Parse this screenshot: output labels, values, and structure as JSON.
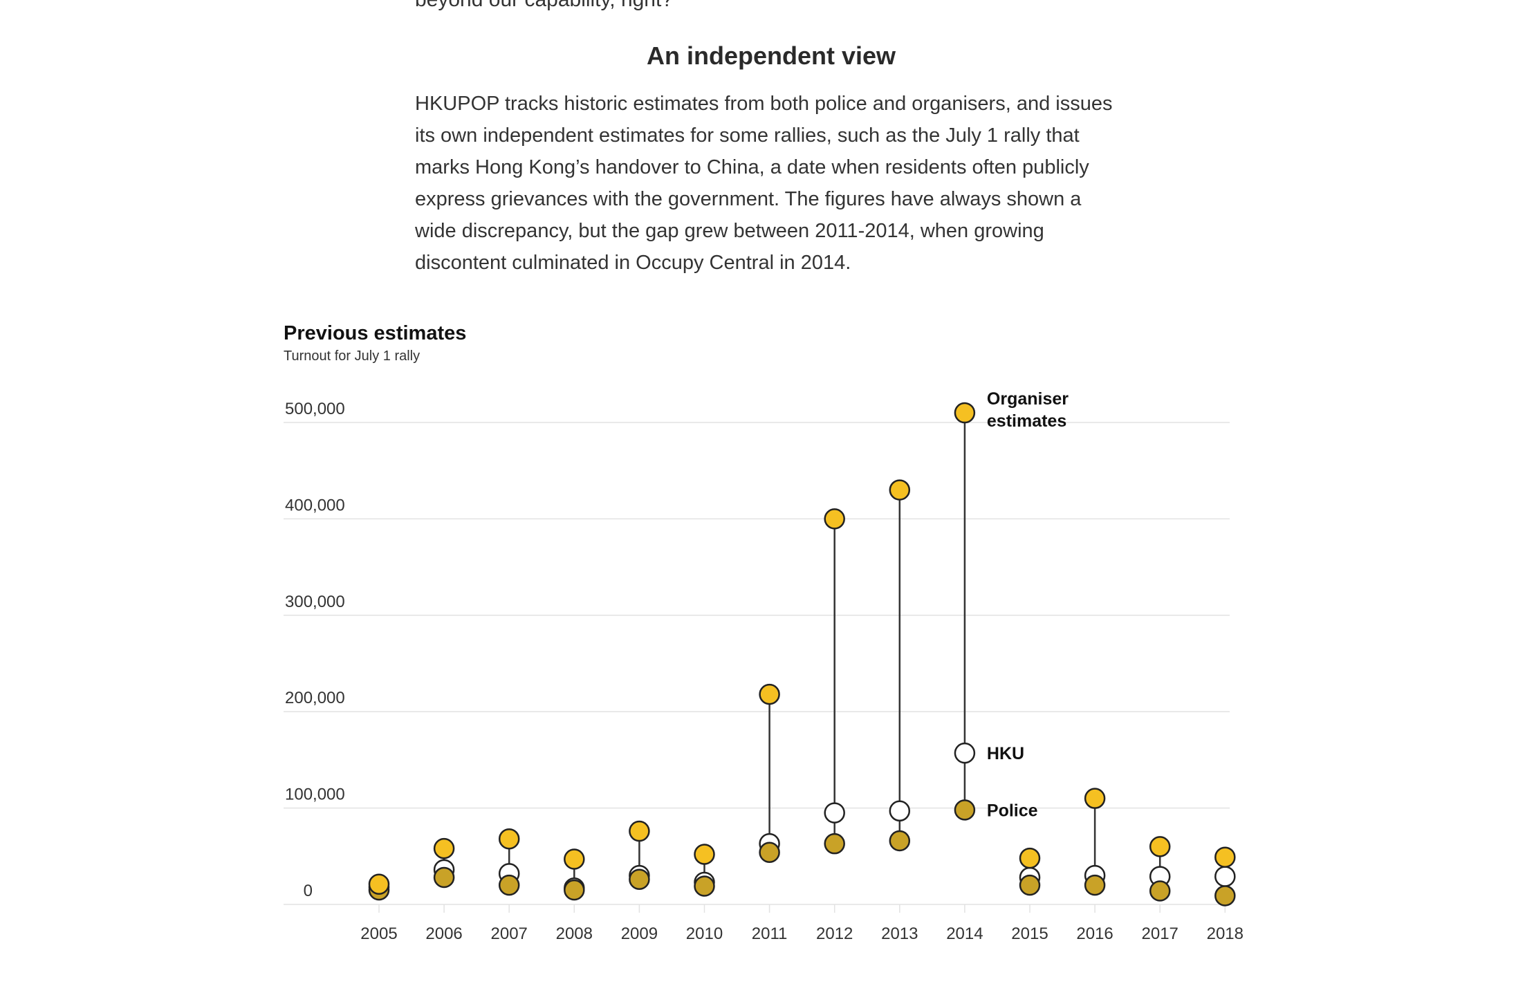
{
  "article": {
    "cut_line": "beyond our capability, right?",
    "section_heading": "An independent view",
    "paragraph": "HKUPOP tracks historic estimates from both police and organisers, and issues its own independent estimates for some rallies, such as the July 1 rally that marks Hong Kong’s handover to China, a date when residents often publicly express grievances with the government. The figures have always shown a wide discrepancy, but the gap grew between 2011-2014, when growing discontent culminated in Occupy Central in 2014."
  },
  "colors": {
    "organiser": "#f5c022",
    "police": "#c9a227",
    "hku_fill": "#ffffff",
    "outline": "#222222",
    "gridline": "#e2e2e2",
    "connector": "#333333"
  },
  "chart_data": {
    "type": "scatter",
    "title": "Previous estimates",
    "subtitle": "Turnout for July 1 rally",
    "x": [
      2005,
      2006,
      2007,
      2008,
      2009,
      2010,
      2011,
      2012,
      2013,
      2014,
      2015,
      2016,
      2017,
      2018
    ],
    "ylim": [
      0,
      500000
    ],
    "yticks": [
      0,
      100000,
      200000,
      300000,
      400000,
      500000
    ],
    "ytick_labels": [
      "0",
      "100,000",
      "200,000",
      "300,000",
      "400,000",
      "500,000"
    ],
    "grid": true,
    "series": [
      {
        "name": "Organiser estimates",
        "values": [
          21000,
          58000,
          68000,
          47000,
          76000,
          52000,
          218000,
          400000,
          430000,
          510000,
          48000,
          110000,
          60000,
          49000
        ]
      },
      {
        "name": "HKU",
        "values": [
          18000,
          36000,
          32000,
          17000,
          30000,
          23000,
          63000,
          95000,
          97000,
          157000,
          28000,
          30000,
          29000,
          29000
        ]
      },
      {
        "name": "Police",
        "values": [
          15000,
          28000,
          20000,
          15000,
          26000,
          19000,
          54000,
          63000,
          66000,
          98000,
          20000,
          20000,
          14000,
          9000
        ]
      }
    ],
    "annotations": [
      {
        "lines": [
          "Organiser",
          "estimates"
        ],
        "series": 0
      },
      {
        "lines": [
          "HKU"
        ],
        "series": 1
      },
      {
        "lines": [
          "Police"
        ],
        "series": 2
      }
    ]
  }
}
